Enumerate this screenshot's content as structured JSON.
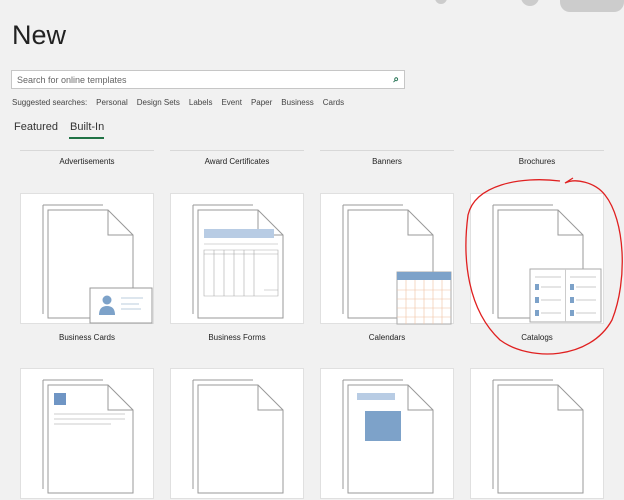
{
  "header": {
    "title": "New"
  },
  "search": {
    "placeholder": "Search for online templates",
    "icon": "search-icon"
  },
  "suggested": {
    "label": "Suggested searches:",
    "items": [
      "Personal",
      "Design Sets",
      "Labels",
      "Event",
      "Paper",
      "Business",
      "Cards"
    ]
  },
  "tabs": [
    {
      "label": "Featured"
    },
    {
      "label": "Built-In",
      "active": true
    }
  ],
  "categories_row0": [
    "Advertisements",
    "Award Certificates",
    "Banners",
    "Brochures"
  ],
  "categories_row1": [
    "Business Cards",
    "Business Forms",
    "Calendars",
    "Catalogs"
  ],
  "colors": {
    "accent": "#217346",
    "thumb_blue": "#7da2c9",
    "annotation": "#e02020"
  }
}
